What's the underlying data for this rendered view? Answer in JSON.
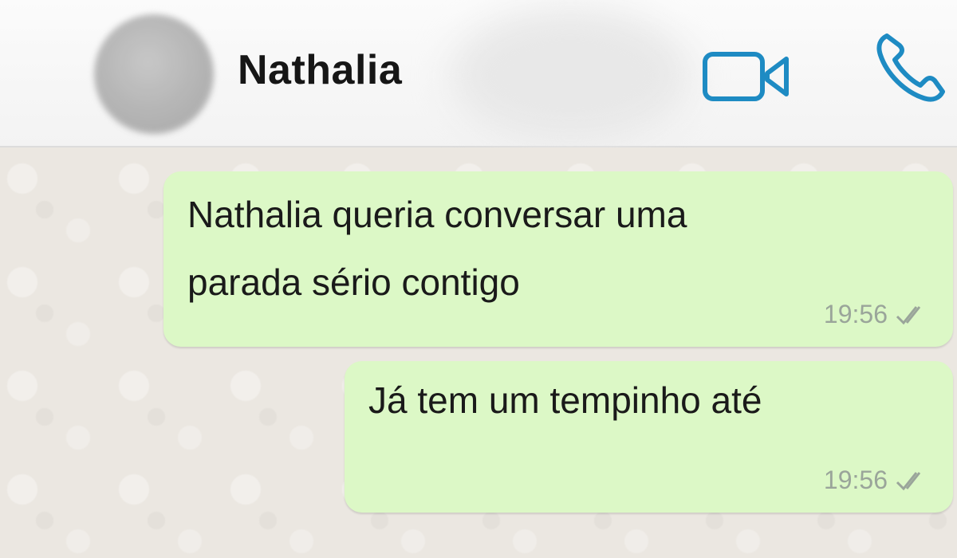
{
  "header": {
    "contact_name": "Nathalia",
    "icons": {
      "video": "video-camera-icon",
      "call": "phone-icon"
    },
    "accent_color": "#1e8bc3"
  },
  "messages": [
    {
      "direction": "outgoing",
      "text": "Nathalia queria conversar uma\nparada sério contigo",
      "time": "19:56",
      "status": "read-double-check"
    },
    {
      "direction": "outgoing",
      "text": "Já tem um tempinho até",
      "time": "19:56",
      "status": "read-double-check"
    }
  ],
  "colors": {
    "bubble_outgoing": "#dcf8c6",
    "chat_background": "#ebe7e1",
    "header_background": "#f7f7f7"
  }
}
